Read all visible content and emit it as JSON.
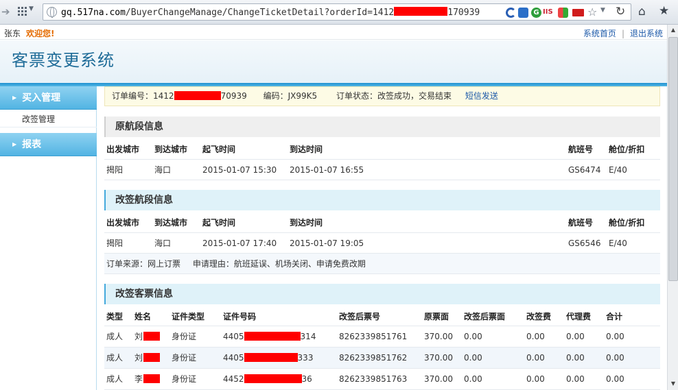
{
  "browser": {
    "url_host": "gq.517na.com",
    "url_path": "/BuyerChangeManage/ChangeTicketDetail?orderId=1412",
    "url_tail": "170939",
    "ext_g": "G",
    "ext_iis": "IIS"
  },
  "topbar": {
    "user": "张东",
    "welcome": "欢迎您!",
    "home_link": "系统首页",
    "separator": "|",
    "logout_link": "退出系统"
  },
  "header": {
    "title": "客票变更系统"
  },
  "sidebar": {
    "items": [
      {
        "label": "买入管理"
      },
      {
        "label": "改签管理"
      },
      {
        "label": "报表"
      }
    ]
  },
  "order": {
    "order_no_label": "订单编号：",
    "order_no_head": "1412",
    "order_no_tail": "70939",
    "code_label": "编码：",
    "code": "JX99K5",
    "status_label": "订单状态：",
    "status": "改签成功，交易结束",
    "sms_link": "短信发送"
  },
  "original": {
    "title": "原航段信息",
    "headers": [
      "出发城市",
      "到达城市",
      "起飞时间",
      "到达时间",
      "航班号",
      "舱位/折扣"
    ],
    "row": [
      "揭阳",
      "海口",
      "2015-01-07 15:30",
      "2015-01-07 16:55",
      "GS6474",
      "E/40"
    ]
  },
  "changed": {
    "title": "改签航段信息",
    "headers": [
      "出发城市",
      "到达城市",
      "起飞时间",
      "到达时间",
      "航班号",
      "舱位/折扣"
    ],
    "row": [
      "揭阳",
      "海口",
      "2015-01-07 17:40",
      "2015-01-07 19:05",
      "GS6546",
      "E/40"
    ],
    "source_label": "订单来源：",
    "source": "网上订票",
    "reason_label": "申请理由：",
    "reason": "航班延误、机场关闭、申请免费改期"
  },
  "tickets": {
    "title": "改签客票信息",
    "headers": [
      "类型",
      "姓名",
      "证件类型",
      "证件号码",
      "改签后票号",
      "原票面",
      "改签后票面",
      "改签费",
      "代理费",
      "合计"
    ],
    "rows": [
      {
        "type": "成人",
        "name": "刘",
        "id_type": "身份证",
        "id_head": "4405",
        "id_tail": "314",
        "ticket": "8262339851761",
        "orig": "370.00",
        "new": "0.00",
        "fee": "0.00",
        "agent": "0.00",
        "total": "0.00"
      },
      {
        "type": "成人",
        "name": "刘",
        "id_type": "身份证",
        "id_head": "4405",
        "id_tail": "333",
        "ticket": "8262339851762",
        "orig": "370.00",
        "new": "0.00",
        "fee": "0.00",
        "agent": "0.00",
        "total": "0.00"
      },
      {
        "type": "成人",
        "name": "李",
        "id_type": "身份证",
        "id_head": "4452",
        "id_tail": "36",
        "ticket": "8262339851763",
        "orig": "370.00",
        "new": "0.00",
        "fee": "0.00",
        "agent": "0.00",
        "total": "0.00"
      }
    ]
  }
}
